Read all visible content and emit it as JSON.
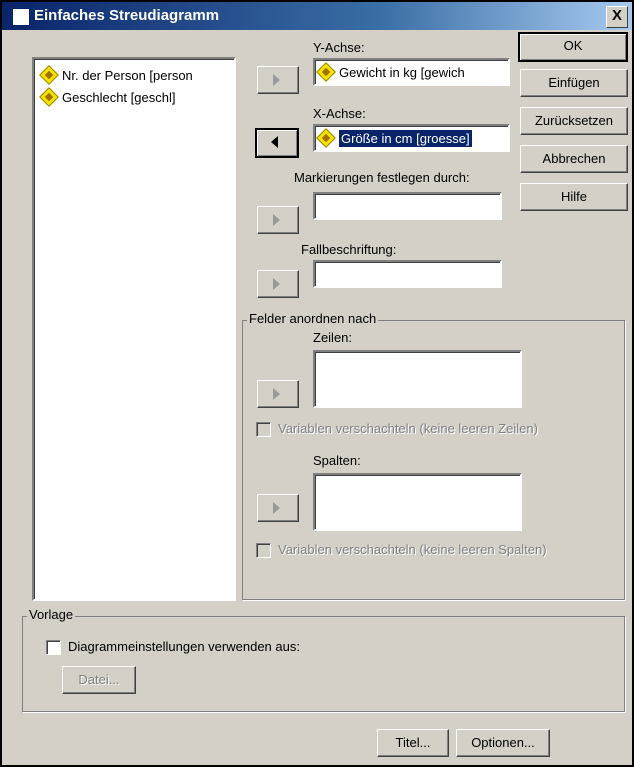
{
  "window": {
    "title": "Einfaches Streudiagramm",
    "close_label": "X"
  },
  "variable_list": [
    {
      "label": "Nr. der Person [person",
      "icon": "scale-variable-icon"
    },
    {
      "label": "Geschlecht [geschl]",
      "icon": "scale-variable-icon"
    }
  ],
  "y_axis": {
    "label": "Y-Achse:",
    "value": "Gewicht in kg [gewich"
  },
  "x_axis": {
    "label": "X-Achse:",
    "value": "Größe in cm [groesse]"
  },
  "markers": {
    "label": "Markierungen festlegen durch:",
    "value": ""
  },
  "case_labels": {
    "label": "Fallbeschriftung:",
    "value": ""
  },
  "panel": {
    "title": "Felder anordnen nach",
    "rows_label": "Zeilen:",
    "rows_nest": "Variablen verschachteln (keine leeren Zeilen)",
    "cols_label": "Spalten:",
    "cols_nest": "Variablen verschachteln (keine leeren Spalten)"
  },
  "buttons": {
    "ok": "OK",
    "paste": "Einfügen",
    "reset": "Zurücksetzen",
    "cancel": "Abbrechen",
    "help": "Hilfe",
    "titles": "Titel...",
    "options": "Optionen..."
  },
  "template": {
    "title": "Vorlage",
    "checkbox": "Diagrammeinstellungen verwenden aus:",
    "file_button": "Datei..."
  },
  "colors": {
    "title_bar": "#0a246a",
    "selection": "#0a246a",
    "dialog_bg": "#d4d0c8"
  }
}
